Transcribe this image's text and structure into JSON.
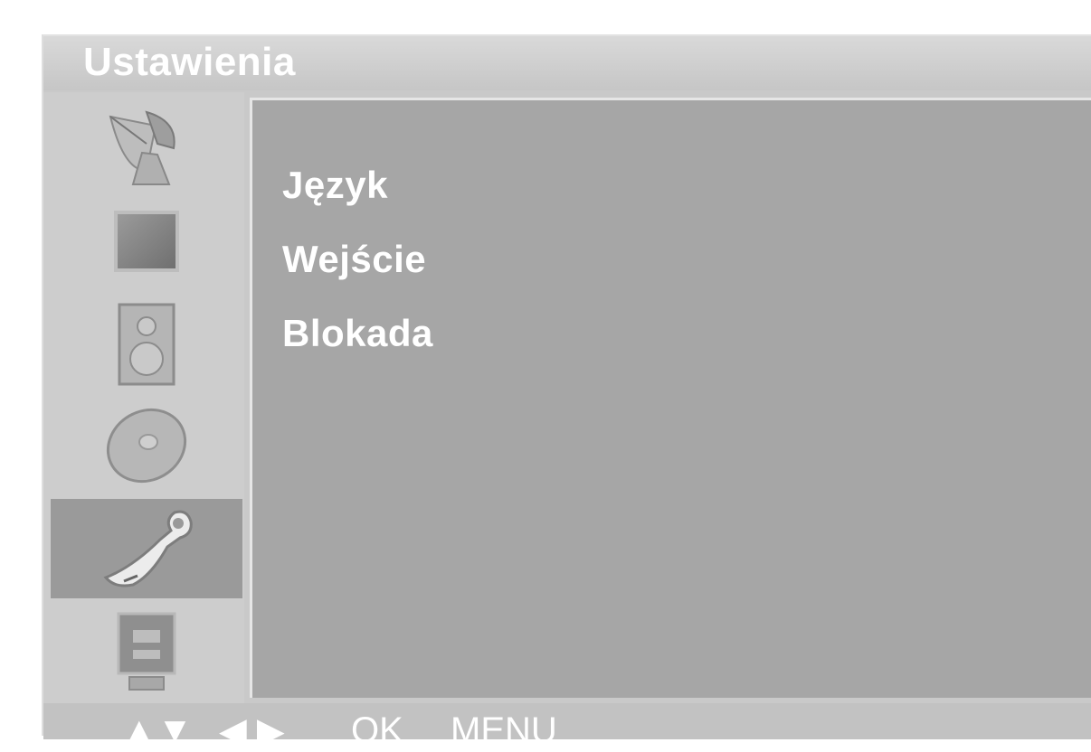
{
  "window": {
    "title": "Ustawienia"
  },
  "sidebar": {
    "items": [
      {
        "icon": "satellite-dish-icon",
        "selected": false
      },
      {
        "icon": "picture-icon",
        "selected": false
      },
      {
        "icon": "speaker-icon",
        "selected": false
      },
      {
        "icon": "disc-icon",
        "selected": false
      },
      {
        "icon": "wrench-icon",
        "selected": true
      },
      {
        "icon": "tv-input-icon",
        "selected": false
      }
    ]
  },
  "menu": {
    "items": [
      {
        "label": "Język"
      },
      {
        "label": "Wejście"
      },
      {
        "label": "Blokada"
      }
    ]
  },
  "footer": {
    "arrows_updown": "▲▼",
    "arrows_leftright": "◀ ▶",
    "ok_label": "OK",
    "menu_label": "MENU"
  },
  "colors": {
    "panel": "#c9c9c9",
    "content": "#a6a6a6",
    "selected": "#9a9a9a",
    "text": "#ffffff"
  }
}
